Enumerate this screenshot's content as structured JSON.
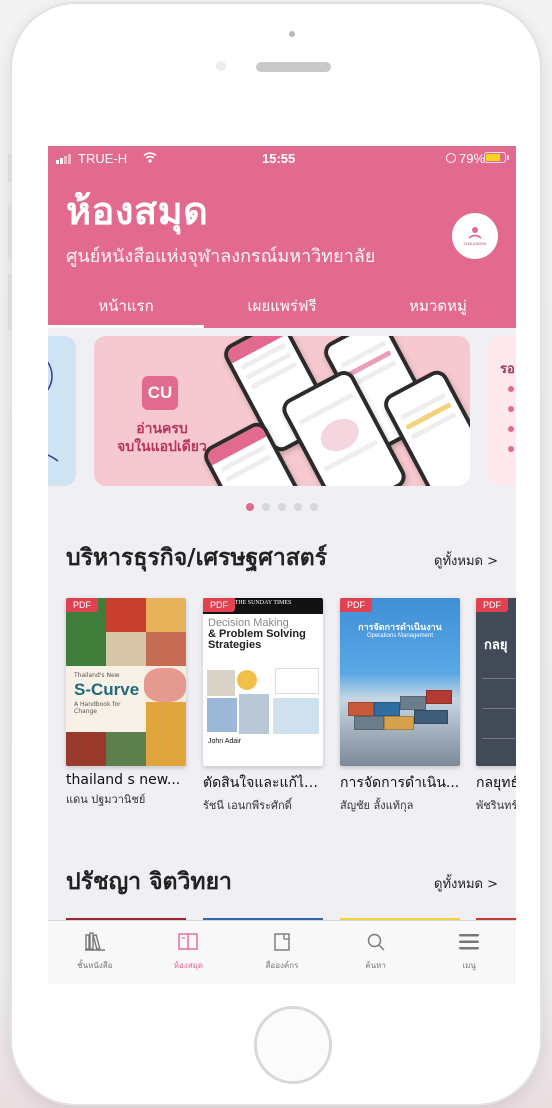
{
  "status_bar": {
    "carrier": "TRUE-H",
    "time": "15:55",
    "battery": "79%"
  },
  "header": {
    "title": "ห้องสมุด",
    "subtitle": "ศูนย์หนังสือแห่งจุฬาลงกรณ์มหาวิทยาลัย",
    "logo_text": "CHULA BOOK"
  },
  "tabs": [
    {
      "label": "หน้าแรก",
      "active": true
    },
    {
      "label": "เผยแพร่ฟรี",
      "active": false
    },
    {
      "label": "หมวดหมู่",
      "active": false
    }
  ],
  "banner": {
    "logo_text": "CU",
    "line1": "อ่านครบ",
    "line2": "จบในแอปเดียว",
    "right_peek_text": "รอ",
    "page_count": 5,
    "active_page": 1
  },
  "sections": [
    {
      "title": "บริหารธุรกิจ/เศรษฐศาสตร์",
      "see_all": "ดูทั้งหมด >",
      "books": [
        {
          "tag": "PDF",
          "title": "thailand s new...",
          "author": "แดน ปฐมวานิชย์",
          "cover_text1": "Thailand's New",
          "cover_text2": "S-Curve",
          "cover_text3": "A Handbook for Change"
        },
        {
          "tag": "PDF",
          "title": "ตัดสินใจและแก้ไข...",
          "author": "รัชนี เอนกพีระศักดิ์",
          "cover_top": "THE SUNDAY TIMES",
          "cover_text1": "Decision Making",
          "cover_text2": "& Problem Solving Strategies",
          "cover_author": "John Adair"
        },
        {
          "tag": "PDF",
          "title": "การจัดการดำเนิน...",
          "author": "สัญชัย ลั้งแท้กุล",
          "cover_text1": "การจัดการดำเนินงาน",
          "cover_text2": "Operations Management"
        },
        {
          "tag": "PDF",
          "title": "กลยุทธ์...",
          "author": "พัชรินทร์...",
          "cover_text1": "กลยุ"
        }
      ]
    },
    {
      "title": "ปรัชญา จิตวิทยา",
      "see_all": "ดูทั้งหมด >"
    }
  ],
  "tabbar": [
    {
      "label": "ชั้นหนังสือ",
      "icon": "bookshelf-icon",
      "active": false
    },
    {
      "label": "ห้องสมุด",
      "icon": "library-book-icon",
      "active": true
    },
    {
      "label": "สื่อองค์กร",
      "icon": "organization-media-icon",
      "active": false
    },
    {
      "label": "ค้นหา",
      "icon": "search-icon",
      "active": false
    },
    {
      "label": "เมนู",
      "icon": "menu-icon",
      "active": false
    }
  ],
  "colors": {
    "brand": "#e26a8e",
    "pdf_tag": "#e0424f",
    "background": "#efeff4"
  }
}
